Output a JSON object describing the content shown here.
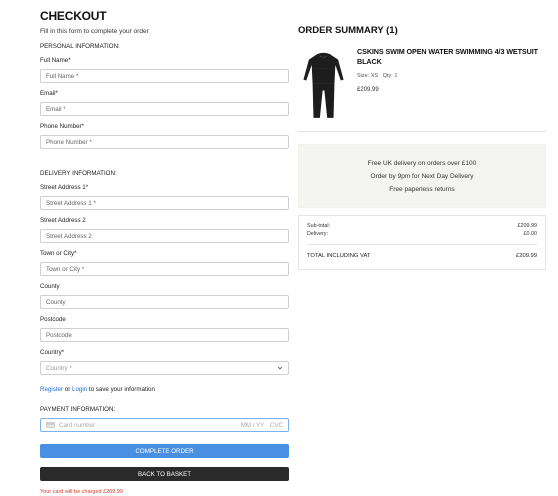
{
  "checkout": {
    "title": "CHECKOUT",
    "subtitle": "Fill in this form to complete your order",
    "personal_heading": "PERSONAL INFORMATION:",
    "full_name_label": "Full Name*",
    "full_name_placeholder": "Full Name *",
    "email_label": "Email*",
    "email_placeholder": "Email *",
    "phone_label": "Phone Number*",
    "phone_placeholder": "Phone Number *",
    "delivery_heading": "DELIVERY INFORMATION:",
    "street1_label": "Street Address 1*",
    "street1_placeholder": "Street Address 1 *",
    "street2_label": "Street Address 2",
    "street2_placeholder": "Street Address 2",
    "town_label": "Town or City*",
    "town_placeholder": "Town or City *",
    "county_label": "County",
    "county_placeholder": "County",
    "postcode_label": "Postcode",
    "postcode_placeholder": "Postcode",
    "country_label": "Country*",
    "country_value": "Country *",
    "register_link": "Register",
    "or_text": "or",
    "login_link": "Login",
    "save_info_text": "to save your information",
    "payment_heading": "PAYMENT INFORMATION:",
    "card_placeholder": "Card number",
    "card_expiry": "MM / YY",
    "card_cvc": "CVC",
    "complete_button": "COMPLETE ORDER",
    "back_button": "BACK TO BASKET",
    "charge_notice": "Your card will be charged £209.99"
  },
  "summary": {
    "title": "ORDER SUMMARY (1)",
    "product_name": "CSKINS SWIM OPEN WATER SWIMMING 4/3 WETSUIT BLACK",
    "size_text": "Size: XS",
    "qty_text": "Qty: 1",
    "price": "£209.99",
    "delivery_lines": [
      "Free UK delivery on orders over £100",
      "Order by 9pm for Next Day Delivery",
      "Free paperless returns"
    ],
    "subtotal_label": "Sub-total:",
    "subtotal_value": "£209.99",
    "delivery_label": "Delivery:",
    "delivery_value": "£0.00",
    "total_label": "TOTAL INCLUDING VAT",
    "total_value": "£209.99"
  },
  "colors": {
    "primary_button": "#4a90e2",
    "dark_button": "#2a2a2a",
    "link": "#1a6fd6",
    "notice": "#d23b2a"
  },
  "icons": [
    "card-icon",
    "chevron-down-icon",
    "wetsuit-image"
  ]
}
